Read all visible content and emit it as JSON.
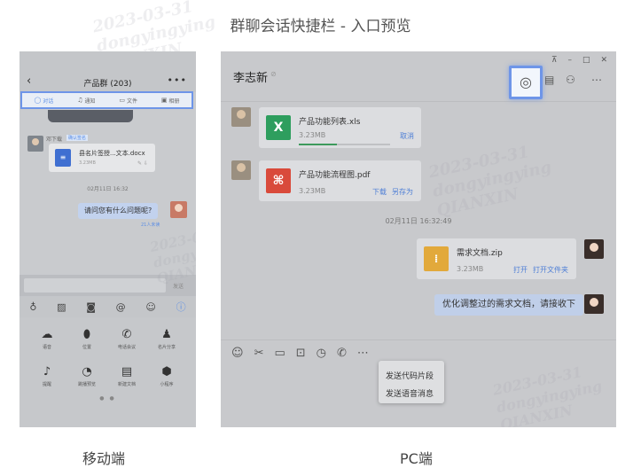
{
  "page": {
    "title": "群聊会话快捷栏 - 入口预览"
  },
  "captions": {
    "mobile": "移动端",
    "pc": "PC端"
  },
  "watermark": {
    "date": "2023-03-31",
    "user": "dongyingying",
    "org": "QIANXIN"
  },
  "mobile": {
    "header": {
      "back_icon": "chevron-left-icon",
      "title": "产品群 (203)",
      "more_icon": "more-icon"
    },
    "tabs": [
      {
        "label": "对话",
        "icon": "chat-icon",
        "active": true
      },
      {
        "label": "通知",
        "icon": "bell-icon",
        "active": false
      },
      {
        "label": "文件",
        "icon": "folder-icon",
        "active": false
      },
      {
        "label": "相册",
        "icon": "image-icon",
        "active": false
      }
    ],
    "file_message": {
      "sender": "邓下载",
      "tag": "确认签名",
      "name": "县名片签授...文本.docx",
      "size": "3.23MB",
      "actions": "✎ ⇩"
    },
    "date_divider": "02月11日 16:32",
    "text_message": {
      "text": "请问您有什么问题呢?",
      "read_status": "21人未读"
    },
    "input": {
      "send_label": "发送"
    },
    "toolbar_icons": [
      "mic-icon",
      "image-icon",
      "camera-icon",
      "at-icon",
      "emoji-icon",
      "info-icon"
    ],
    "grid": [
      {
        "label": "语音",
        "icon": "cloud-icon"
      },
      {
        "label": "位置",
        "icon": "location-icon"
      },
      {
        "label": "电话会议",
        "icon": "phone-icon"
      },
      {
        "label": "名片分享",
        "icon": "contact-icon"
      },
      {
        "label": "提醒",
        "icon": "bell-icon"
      },
      {
        "label": "跳播预览",
        "icon": "gauge-icon"
      },
      {
        "label": "新建文档",
        "icon": "document-icon"
      },
      {
        "label": "小程序",
        "icon": "cube-icon"
      }
    ],
    "page_dots": "● ●"
  },
  "pc": {
    "header": {
      "name": "李志新",
      "mark": "⊘",
      "window_controls": [
        "⊼",
        "–",
        "□",
        "✕"
      ]
    },
    "tools": [
      "code-snippet-icon",
      "document-icon",
      "contacts-icon",
      "more-icon"
    ],
    "messages": {
      "file1": {
        "name": "产品功能列表.xls",
        "size": "3.23MB",
        "action": "取消",
        "icon_letter": "X",
        "progress": 0.42
      },
      "file2": {
        "name": "产品功能流程图.pdf",
        "size": "3.23MB",
        "action_download": "下载",
        "action_save": "另存为",
        "icon_letter": "⌘"
      },
      "date": "02月11日 16:32:49",
      "file3": {
        "name": "需求文档.zip",
        "size": "3.23MB",
        "action_open": "打开",
        "action_folder": "打开文件夹"
      },
      "text": "优化调整过的需求文档，请接收下"
    },
    "input_toolbar": [
      "emoji-icon",
      "scissors-icon",
      "folder-icon",
      "screenshot-icon",
      "clock-icon",
      "phone-icon",
      "more-icon"
    ],
    "menu": [
      "发送代码片段",
      "发送语音消息"
    ]
  },
  "colors": {
    "accent": "#5b8ee6",
    "highlight_border": "#6e95e8",
    "excel": "#2e9e5e",
    "pdf": "#d94a3b",
    "zip": "#e2a93b",
    "word": "#3f6fd1"
  }
}
